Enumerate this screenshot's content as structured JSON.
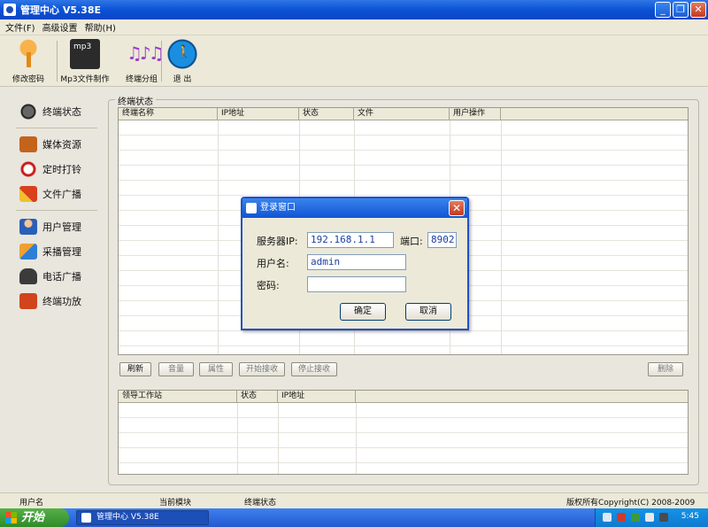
{
  "window": {
    "title": "管理中心 V5.38E",
    "buttons": [
      "_",
      "❐",
      "✕"
    ]
  },
  "menu": [
    "文件(F)",
    "高级设置",
    "帮助(H)"
  ],
  "toolbar": {
    "items": [
      {
        "label": "修改密码",
        "icon": "key-icon"
      },
      {
        "label": "Mp3文件制作",
        "icon": "mp3-file-icon"
      },
      {
        "label": "终端分组",
        "icon": "music-notes-icon"
      },
      {
        "label": "退 出",
        "icon": "exit-icon"
      }
    ]
  },
  "sidebar": {
    "items": [
      {
        "label": "终端状态",
        "icon": "terminal-icon",
        "color": "#4a4a4a"
      },
      {
        "label": "媒体资源",
        "icon": "media-icon",
        "color": "#c4631a"
      },
      {
        "label": "定时打铃",
        "icon": "clock-icon",
        "color": "#c81e1e"
      },
      {
        "label": "文件广播",
        "icon": "broadcast-icon",
        "color": "#d9401c"
      },
      {
        "label": "用户管理",
        "icon": "user-icon",
        "color": "#2a5fb8"
      },
      {
        "label": "采播管理",
        "icon": "capture-icon",
        "color": "#2d7fd6"
      },
      {
        "label": "电话广播",
        "icon": "phone-icon",
        "color": "#3b3b3b"
      },
      {
        "label": "终端功放",
        "icon": "amplifier-icon",
        "color": "#d0451b"
      }
    ]
  },
  "terminal_panel": {
    "group_label": "终端状态",
    "columns": [
      "终端名称",
      "IP地址",
      "状态",
      "文件",
      "用户操作"
    ],
    "buttons": [
      "刷新",
      "音量",
      "属性",
      "开始接收",
      "停止接收"
    ],
    "delete_button": "删除"
  },
  "station_grid": {
    "columns": [
      "领导工作站",
      "状态",
      "IP地址"
    ]
  },
  "statusbar": {
    "user": "用户名",
    "current_module": "当前模块",
    "module_value": "终端状态",
    "copyright": "版权所有Copyright(C) 2008-2009"
  },
  "login_dialog": {
    "title": "登录窗口",
    "server_ip_label": "服务器IP:",
    "server_ip": "192.168.1.1",
    "port_label": "端口:",
    "port": "8902",
    "username_label": "用户名:",
    "username": "admin",
    "password_label": "密码:",
    "password": "",
    "ok": "确定",
    "cancel": "取消"
  },
  "taskbar": {
    "start": "开始",
    "task": "管理中心 V5.38E",
    "clock": "5:45"
  }
}
